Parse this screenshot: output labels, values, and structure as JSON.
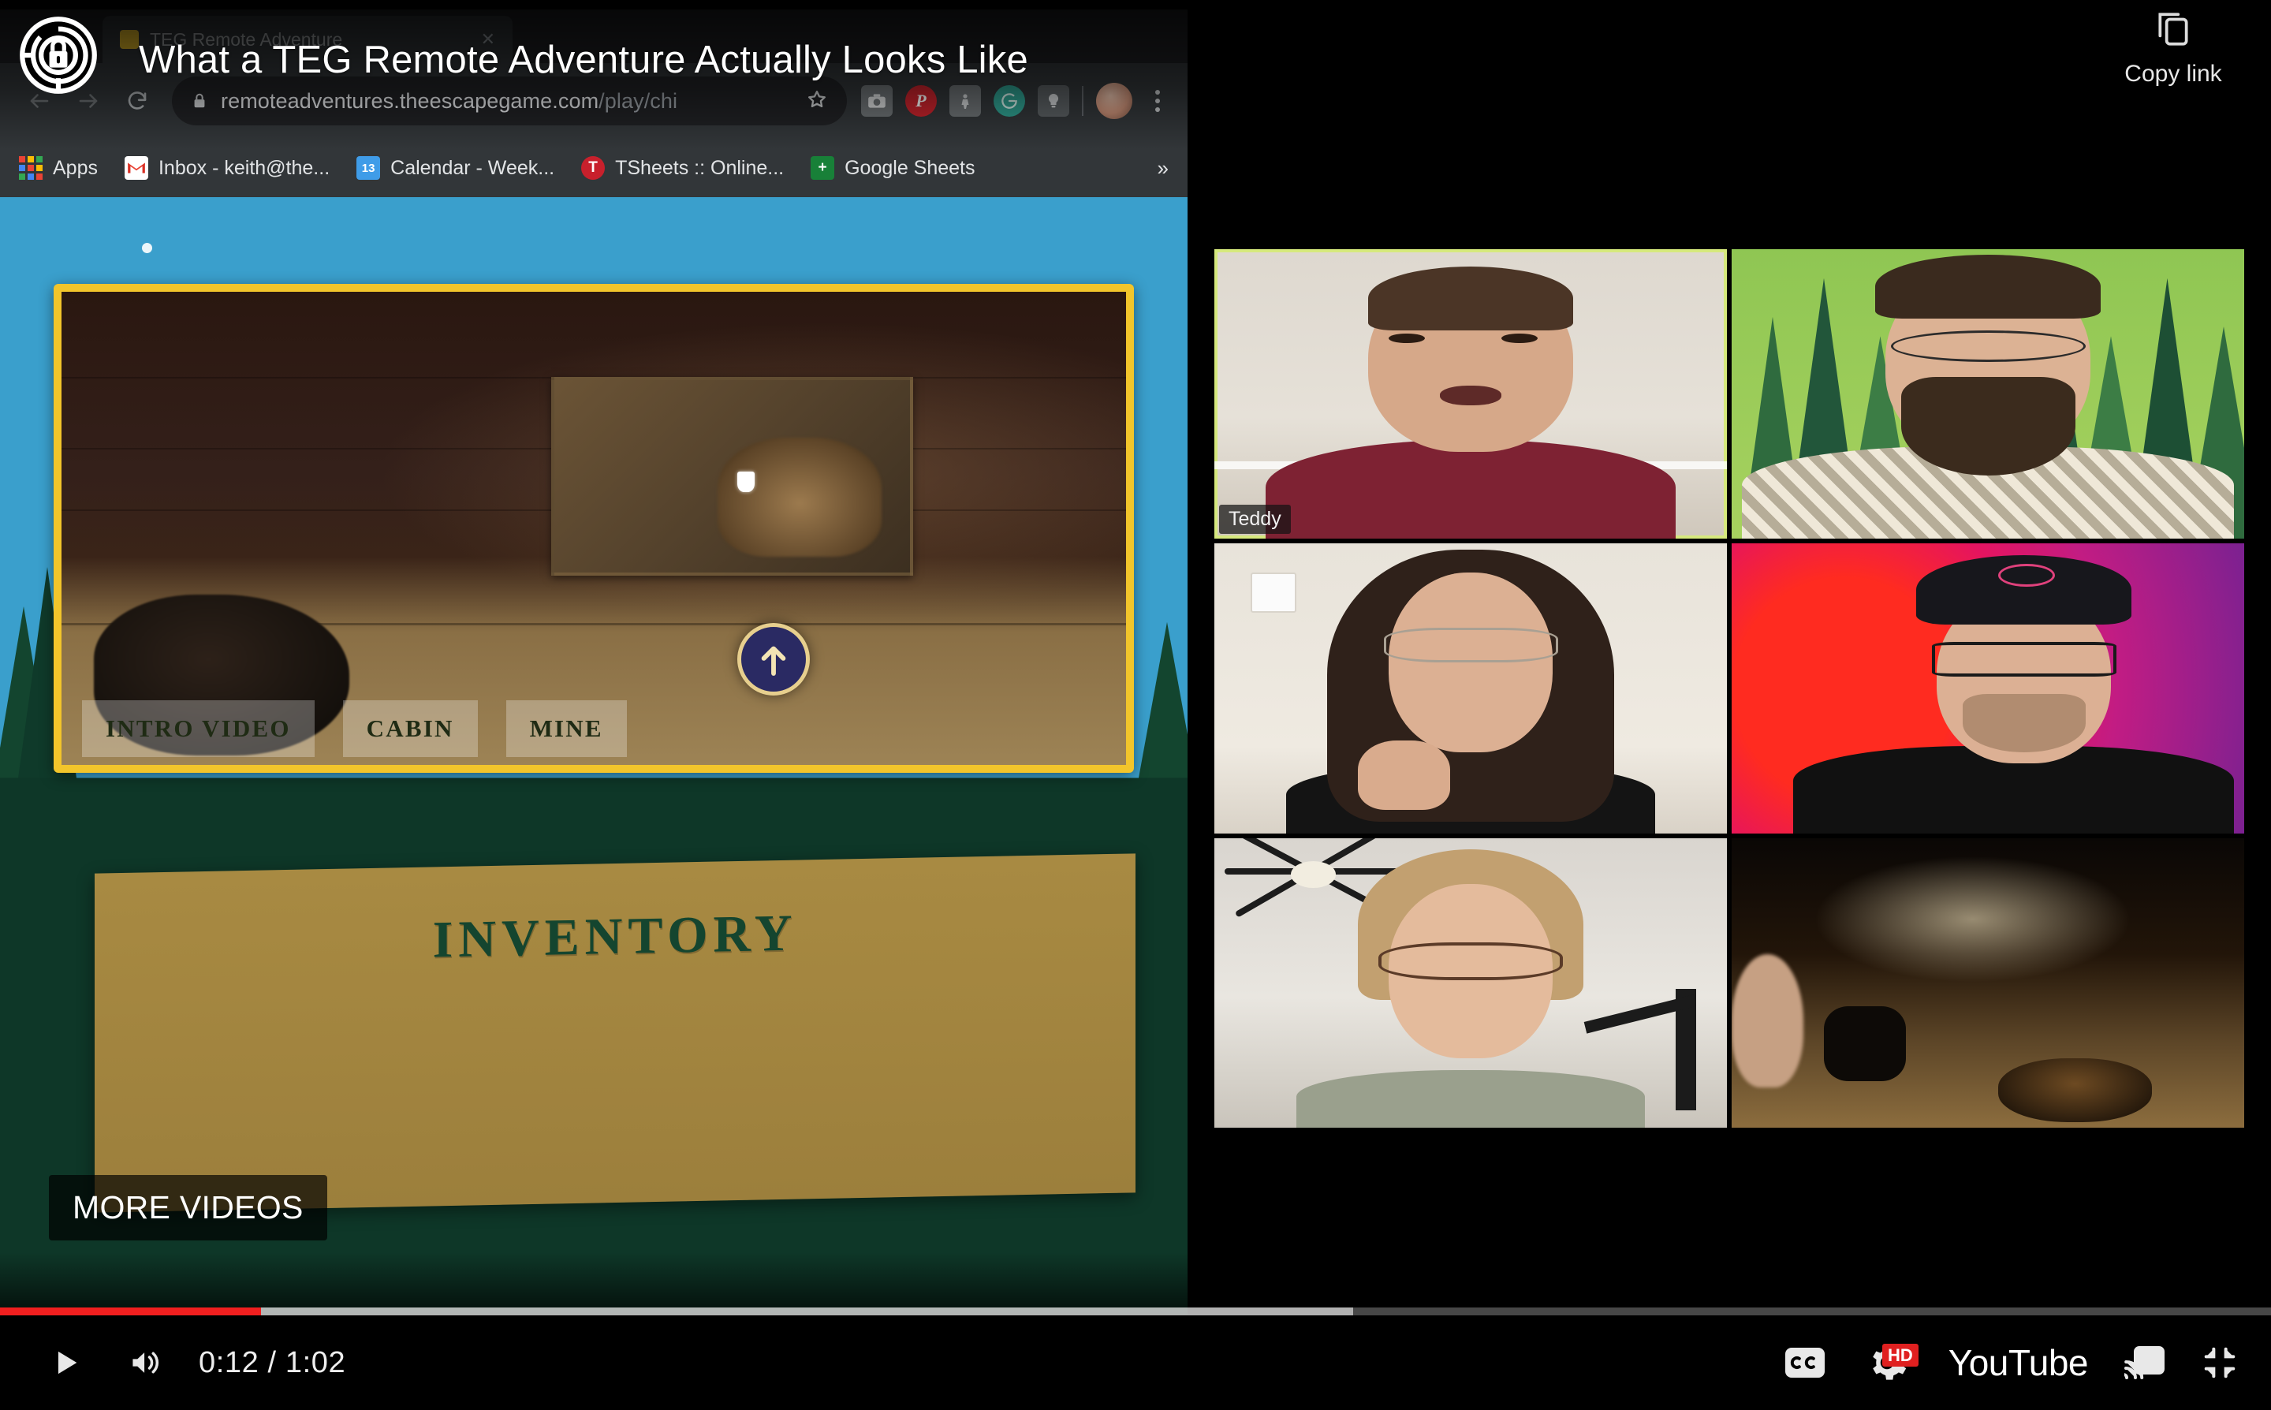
{
  "player": {
    "title": "What a TEG Remote Adventure Actually Looks Like",
    "watermark_icon": "escape-game-target-lock-logo",
    "copy_link": {
      "label": "Copy link",
      "icon": "copy-link-icon"
    },
    "more_videos_label": "MORE VIDEOS",
    "time_display": "0:12 / 1:02",
    "current_time": "0:12",
    "duration": "1:02",
    "progress_percent": 11.5,
    "buffered_percent": 59.6,
    "progress_color": "#f01f1f",
    "controls": {
      "play_icon": "play-icon",
      "volume_icon": "volume-on-icon",
      "captions_icon": "closed-captions-icon",
      "settings_icon": "gear-icon",
      "quality_badge": "HD",
      "logo_text_you": "You",
      "logo_text_tube": "Tube",
      "cast_icon": "cast-icon",
      "size_icon": "collapse-size-icon"
    }
  },
  "browser": {
    "tab": {
      "title": "TEG Remote Adventure",
      "close_icon": "close-icon"
    },
    "nav": {
      "back_icon": "back-arrow-icon",
      "forward_icon": "forward-arrow-icon",
      "reload_icon": "reload-icon"
    },
    "omnibox": {
      "lock_icon": "lock-icon",
      "url_host": "remoteadventures.theescapegame.com",
      "url_path": "/play/chi",
      "bookmark_icon": "star-icon"
    },
    "extensions": [
      {
        "name": "screenshot-extension-icon",
        "glyph": ""
      },
      {
        "name": "pinterest-extension-icon",
        "glyph": "P"
      },
      {
        "name": "grey-extension-icon",
        "glyph": ""
      },
      {
        "name": "grammarly-extension-icon",
        "glyph": "G"
      },
      {
        "name": "lightbulb-extension-icon",
        "glyph": ""
      }
    ],
    "profile_icon": "profile-avatar",
    "menu_icon": "kebab-menu-icon",
    "bookmarks": [
      {
        "label": "Apps",
        "icon": "apps-grid-icon"
      },
      {
        "label": "Inbox - keith@the...",
        "icon": "gmail-icon"
      },
      {
        "label": "Calendar - Week...",
        "icon": "google-calendar-icon"
      },
      {
        "label": "TSheets :: Online...",
        "icon": "tsheets-icon"
      },
      {
        "label": "Google Sheets",
        "icon": "google-sheets-icon"
      }
    ],
    "bookmarks_overflow_icon": "chevron-double-right-icon"
  },
  "game": {
    "nav_arrow_icon": "up-arrow-navigation-icon",
    "tabs": [
      {
        "label": "INTRO VIDEO"
      },
      {
        "label": "CABIN"
      },
      {
        "label": "MINE"
      }
    ],
    "inventory_title": "INVENTORY",
    "sky_color": "#3a9fcc",
    "frame_color": "#f2c52b",
    "forest_color": "#0f3a2a"
  },
  "conference": {
    "active_speaker_highlight": "#d6e97d",
    "tiles": [
      {
        "id": "tile-1",
        "name": "Teddy",
        "active": true
      },
      {
        "id": "tile-2",
        "name": "",
        "active": false
      },
      {
        "id": "tile-3",
        "name": "",
        "active": false
      },
      {
        "id": "tile-4",
        "name": "",
        "active": false
      },
      {
        "id": "tile-5",
        "name": "",
        "active": false
      },
      {
        "id": "tile-6",
        "name": "",
        "active": false
      }
    ]
  }
}
